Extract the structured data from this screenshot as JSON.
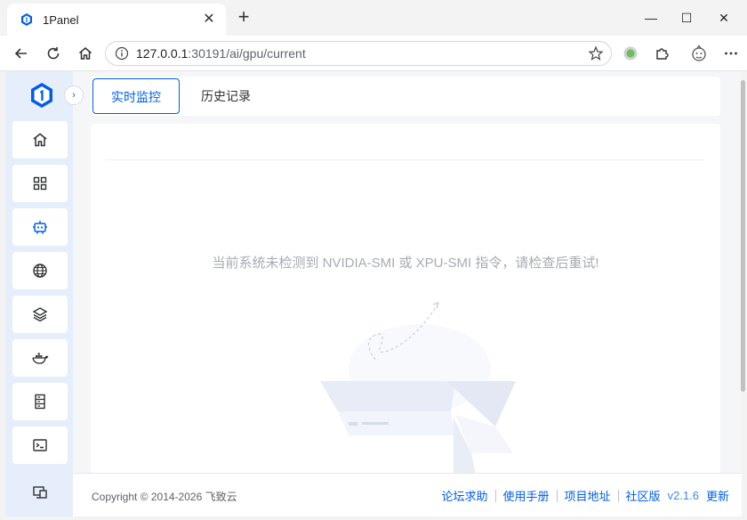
{
  "browser": {
    "tab_title": "1Panel",
    "tab_close": "✕",
    "new_tab": "+",
    "url_host": "127.0.0.1",
    "url_path": ":30191/ai/gpu/current",
    "window_controls": {
      "minimize": "—",
      "maximize": "☐",
      "close": "✕"
    },
    "icons": [
      "back-icon",
      "reload-icon",
      "home-icon",
      "info-icon",
      "star-icon",
      "extension-icon",
      "profile-icon",
      "more-icon"
    ]
  },
  "sidebar": {
    "collapse_glyph": "›",
    "items": [
      {
        "icon": "home-icon",
        "active": false
      },
      {
        "icon": "apps-icon",
        "active": false
      },
      {
        "icon": "ai-robot-icon",
        "active": true
      },
      {
        "icon": "website-globe-icon",
        "active": false
      },
      {
        "icon": "database-layers-icon",
        "active": false
      },
      {
        "icon": "container-docker-icon",
        "active": false
      },
      {
        "icon": "host-server-icon",
        "active": false
      },
      {
        "icon": "terminal-icon",
        "active": false
      },
      {
        "icon": "toolbox-icon",
        "active": false
      }
    ]
  },
  "tabs": {
    "current": "实时监控",
    "history": "历史记录"
  },
  "main": {
    "empty_message": "当前系统未检测到 NVIDIA-SMI 或 XPU-SMI 指令，请检查后重试!"
  },
  "footer": {
    "copyright": "Copyright © 2014-2026 飞致云",
    "links": [
      "论坛求助",
      "使用手册",
      "项目地址",
      "社区版"
    ],
    "version": "v2.1.6",
    "update": "更新"
  },
  "colors": {
    "accent": "#005eeb",
    "sidebar_bg": "#e6eefc",
    "muted_text": "#a8abb2"
  }
}
